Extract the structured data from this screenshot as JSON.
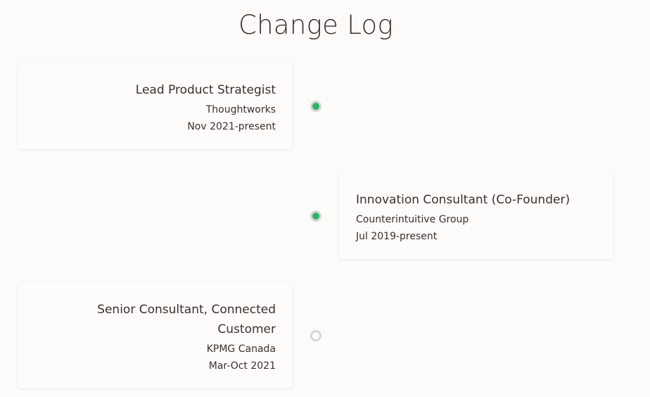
{
  "header": {
    "title": "Change Log"
  },
  "entries": [
    {
      "role": "Lead Product Strategist",
      "org": "Thoughtworks",
      "dates": "Nov 2021-present",
      "status": "active",
      "side": "left"
    },
    {
      "role": "Innovation Consultant (Co-Founder)",
      "org": "Counterintuitive Group",
      "dates": "Jul 2019-present",
      "status": "active",
      "side": "right"
    },
    {
      "role": "Senior Consultant, Connected Customer",
      "org": "KPMG Canada",
      "dates": "Mar-Oct 2021",
      "status": "inactive",
      "side": "left"
    }
  ],
  "colors": {
    "background": "#fcfbf9",
    "text": "#3b2f2a",
    "active_dot": "#2db36a",
    "dot_ring": "#d8d6d3"
  }
}
